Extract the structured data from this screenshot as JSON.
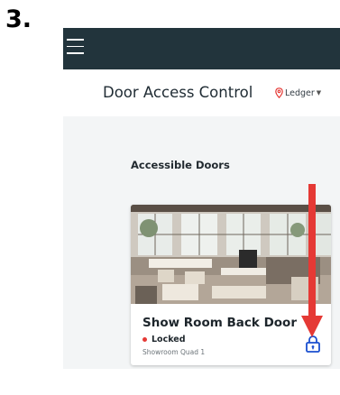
{
  "step": {
    "number": "3."
  },
  "navbar": {
    "menu_icon": "hamburger-menu-icon",
    "background": "#22343c"
  },
  "header": {
    "title": "Door Access Control",
    "location": {
      "icon": "map-pin-icon",
      "label": "Ledger",
      "caret_icon": "caret-down-icon",
      "accent": "#e53935"
    }
  },
  "main": {
    "section_title": "Accessible Doors",
    "doors": [
      {
        "name": "Show Room Back Door",
        "status": "Locked",
        "status_color": "#e53935",
        "zone": "Showroom Quad 1",
        "photo": "office-showroom-photo",
        "action_icon": "lock-icon",
        "action_icon_color": "#1a4fcf"
      }
    ]
  },
  "annotation": {
    "icon": "arrow-down-icon",
    "color": "#e53935"
  }
}
